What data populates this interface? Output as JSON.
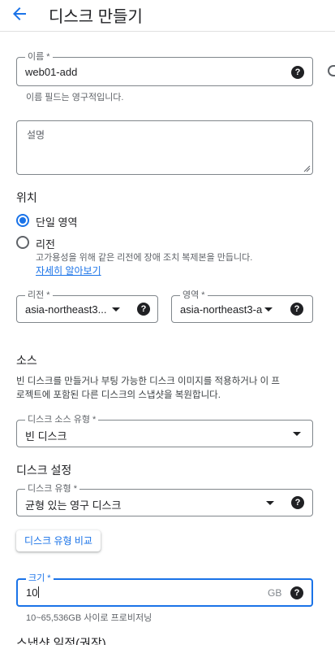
{
  "header": {
    "title": "디스크 만들기"
  },
  "name_field": {
    "label": "이름 *",
    "value": "web01-add",
    "hint": "이름 필드는 영구적입니다."
  },
  "description_field": {
    "placeholder": "설명"
  },
  "location": {
    "title": "위치",
    "options": [
      {
        "label": "단일 영역",
        "selected": true
      },
      {
        "label": "리전",
        "selected": false,
        "description": "고가용성을 위해 같은 리전에 장애 조치 복제본을 만듭니다.",
        "link": "자세히 알아보기"
      }
    ]
  },
  "region_field": {
    "label": "리전 *",
    "value": "asia-northeast3..."
  },
  "zone_field": {
    "label": "영역 *",
    "value": "asia-northeast3-a"
  },
  "source": {
    "title": "소스",
    "description_line1": "빈 디스크를 만들거나 부팅 가능한 디스크 이미지를 적용하거나 이 프",
    "description_line2": "로젝트에 포함된 다른 디스크의 스냅샷을 복원합니다.",
    "source_type_label": "디스크 소스 유형 *",
    "source_type_value": "빈 디스크"
  },
  "disk_settings": {
    "title": "디스크 설정",
    "type_label": "디스크 유형 *",
    "type_value": "균형 있는 영구 디스크",
    "compare_button": "디스크 유형 비교",
    "size_label": "크기 *",
    "size_value": "10",
    "size_unit": "GB",
    "size_hint": "10~65,536GB 사이로 프로비저닝"
  },
  "snapshot": {
    "title": "스냅샷 일정(권장)"
  },
  "icons": {
    "back": "arrow-back-icon",
    "help": "help-icon",
    "dropdown": "chevron-down-icon"
  },
  "colors": {
    "accent": "#1a73e8",
    "text": "#202124",
    "secondary": "#5f6368"
  }
}
